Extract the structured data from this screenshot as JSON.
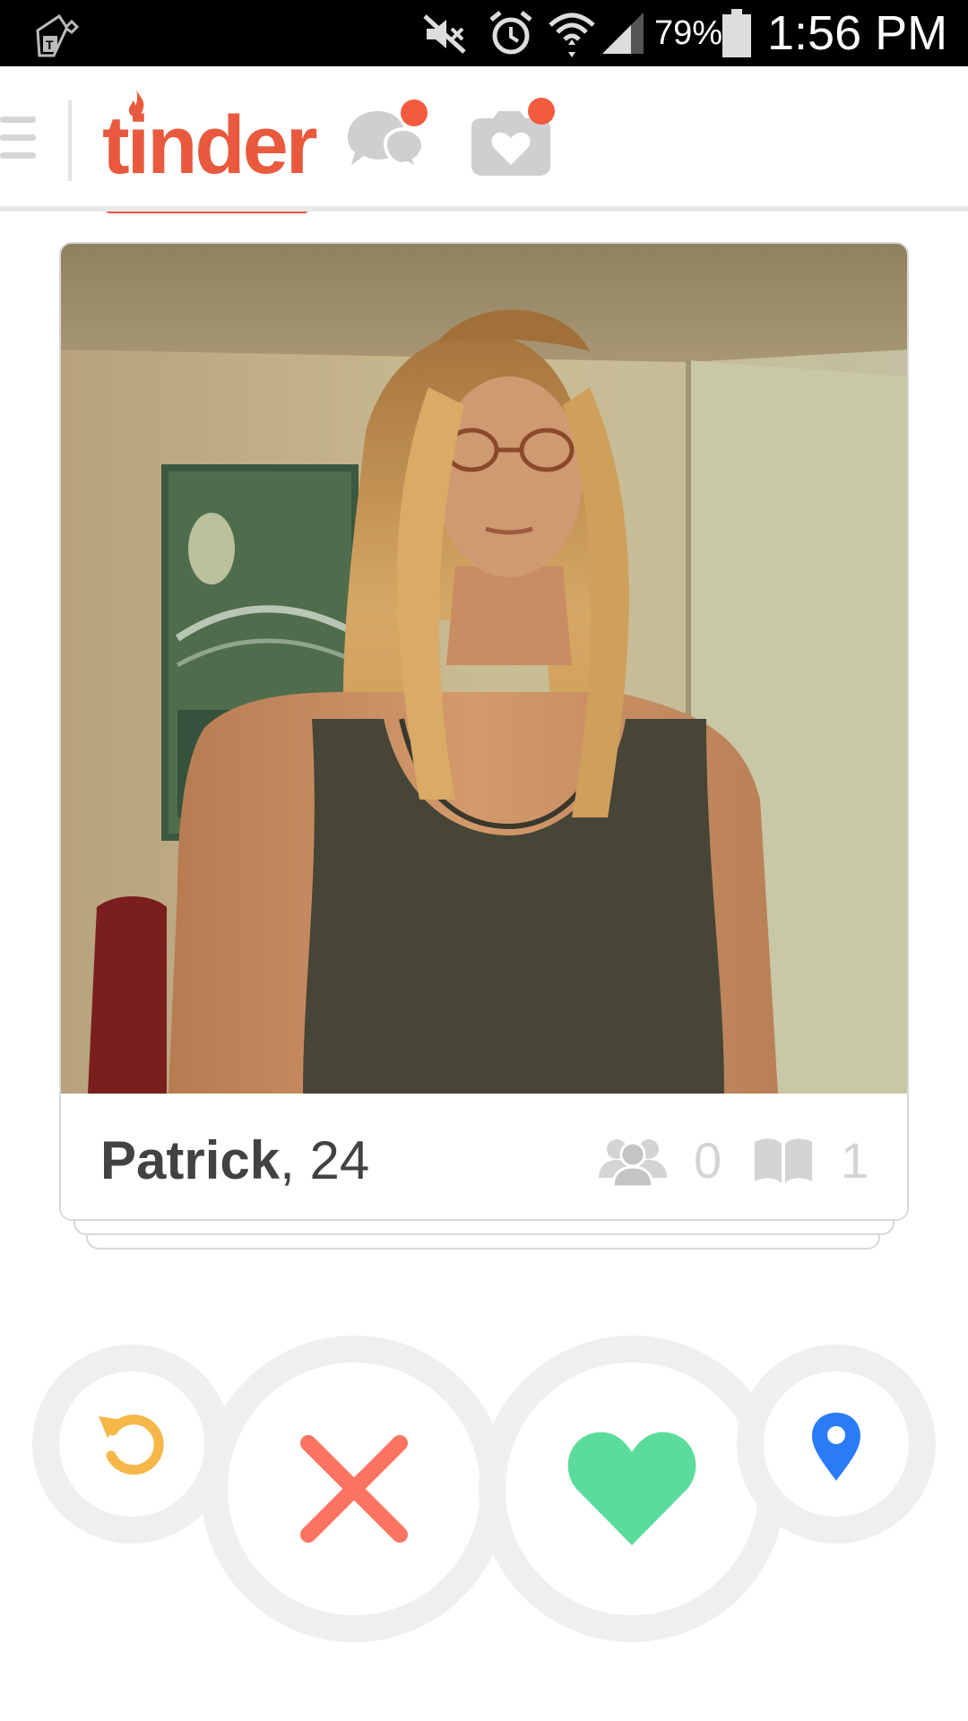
{
  "status_bar": {
    "battery_percent": "79%",
    "time": "1:56 PM",
    "icons": [
      "carrier-icon",
      "mute-icon",
      "alarm-icon",
      "wifi-icon",
      "signal-icon",
      "battery-icon"
    ]
  },
  "nav": {
    "menu_icon": "hamburger-menu-icon",
    "logo_text": "tinder",
    "active_tab": "tinder",
    "tabs": [
      {
        "id": "tinder",
        "icon": "flame-logo"
      },
      {
        "id": "messages",
        "icon": "chat-bubbles-icon",
        "has_notification": true
      },
      {
        "id": "moments",
        "icon": "camera-heart-icon",
        "has_notification": true
      }
    ]
  },
  "profile": {
    "name": "Patrick",
    "separator": ",",
    "age": "24",
    "shared_friends_count": "0",
    "shared_interests_count": "1"
  },
  "actions": [
    {
      "id": "rewind",
      "icon": "rewind-icon",
      "color": "#f5b748"
    },
    {
      "id": "dislike",
      "icon": "x-icon",
      "color": "#fd7462"
    },
    {
      "id": "like",
      "icon": "heart-icon",
      "color": "#5cdc9c"
    },
    {
      "id": "location",
      "icon": "location-pin-icon",
      "color": "#2a7cf6"
    }
  ],
  "colors": {
    "brand": "#e8593d",
    "notification_dot": "#f25b3f",
    "inactive_icon": "#cfcfcf",
    "button_ring": "#efefef"
  }
}
